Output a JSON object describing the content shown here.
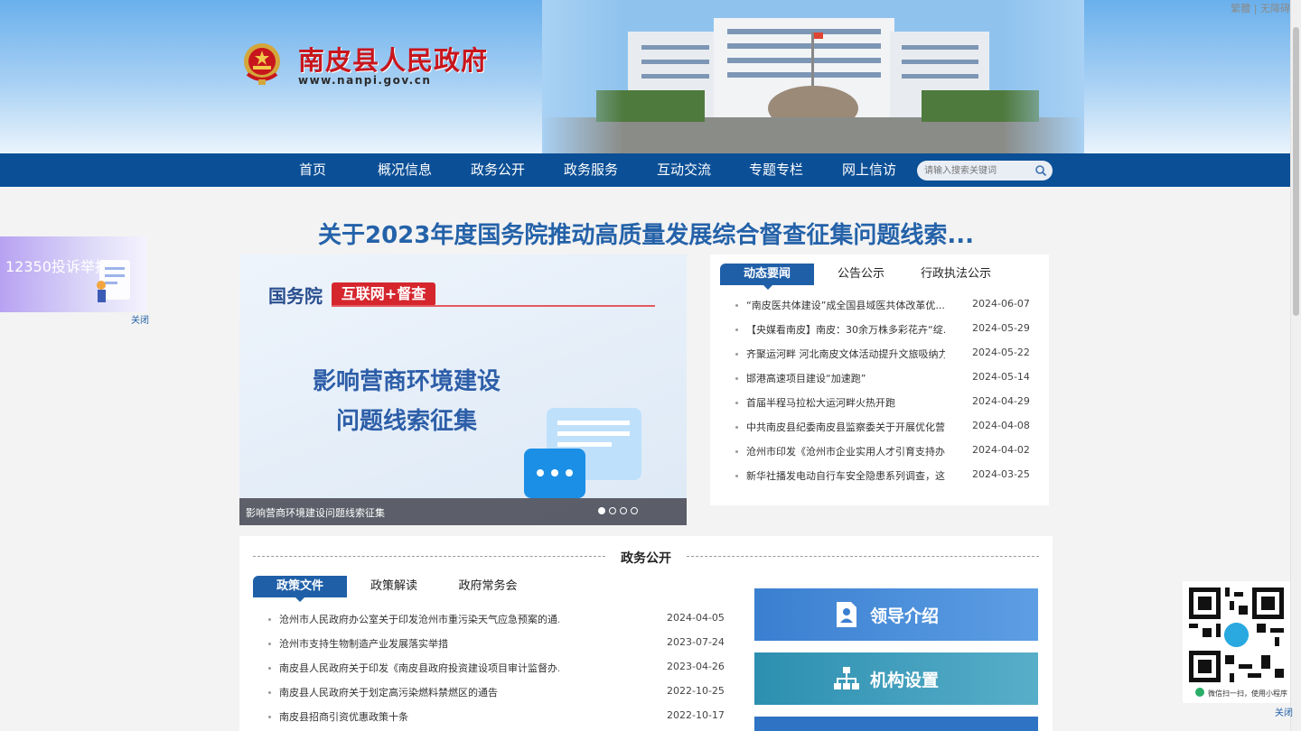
{
  "top_links": {
    "traditional": "繁體",
    "separator": "|",
    "accessibility": "无障碍"
  },
  "header": {
    "title": "南皮县人民政府",
    "url": "www.nanpi.gov.cn"
  },
  "nav": {
    "items": [
      "首页",
      "概况信息",
      "政务公开",
      "政务服务",
      "互动交流",
      "专题专栏",
      "网上信访"
    ],
    "search_placeholder": "请输入搜索关键词"
  },
  "headline": "关于2023年度国务院推动高质量发展综合督查征集问题线索...",
  "float_ad": {
    "text": "12350投诉举报",
    "close": "关闭"
  },
  "slideshow": {
    "org": "国务院",
    "tag": "互联网+督查",
    "heading_line1": "影响营商环境建设",
    "heading_line2": "问题线索征集",
    "caption": "影响营商环境建设问题线索征集",
    "dot_count": 4,
    "active_dot": 1
  },
  "news": {
    "tabs": [
      "动态要闻",
      "公告公示",
      "行政执法公示"
    ],
    "items": [
      {
        "title": "“南皮医共体建设”成全国县域医共体改革优...",
        "date": "2024-06-07"
      },
      {
        "title": "【央媒看南皮】南皮：30余万株多彩花卉“绽...",
        "date": "2024-05-29"
      },
      {
        "title": "齐聚运河畔 河北南皮文体活动提升文旅吸纳力",
        "date": "2024-05-22"
      },
      {
        "title": "邯港高速项目建设“加速跑”",
        "date": "2024-05-14"
      },
      {
        "title": "首届半程马拉松大运河畔火热开跑",
        "date": "2024-04-29"
      },
      {
        "title": "中共南皮县纪委南皮县监察委关于开展优化营...",
        "date": "2024-04-08"
      },
      {
        "title": "沧州市印发《沧州市企业实用人才引育支持办...",
        "date": "2024-04-02"
      },
      {
        "title": "新华社播发电动自行车安全隐患系列调查，这...",
        "date": "2024-03-25"
      }
    ]
  },
  "gov_open": {
    "section_title": "政务公开",
    "tabs": [
      "政策文件",
      "政策解读",
      "政府常务会"
    ],
    "items": [
      {
        "title": "沧州市人民政府办公室关于印发沧州市重污染天气应急预案的通...",
        "date": "2024-04-05"
      },
      {
        "title": "沧州市支持生物制造产业发展落实举措",
        "date": "2023-07-24"
      },
      {
        "title": "南皮县人民政府关于印发《南皮县政府投资建设项目审计监督办...",
        "date": "2023-04-26"
      },
      {
        "title": "南皮县人民政府关于划定高污染燃料禁燃区的通告",
        "date": "2022-10-25"
      },
      {
        "title": "南皮县招商引资优惠政策十条",
        "date": "2022-10-17"
      }
    ],
    "features": [
      {
        "label": "领导介绍",
        "icon": "person-document-icon"
      },
      {
        "label": "机构设置",
        "icon": "org-chart-icon"
      }
    ]
  },
  "qr_panel": {
    "text": "微信扫一扫，使用小程序",
    "close": "关闭"
  },
  "colors": {
    "nav_bg": "#0b4f96",
    "accent_blue": "#1f5fa8",
    "title_red": "#c8161d",
    "headline_blue": "#2462a9"
  }
}
